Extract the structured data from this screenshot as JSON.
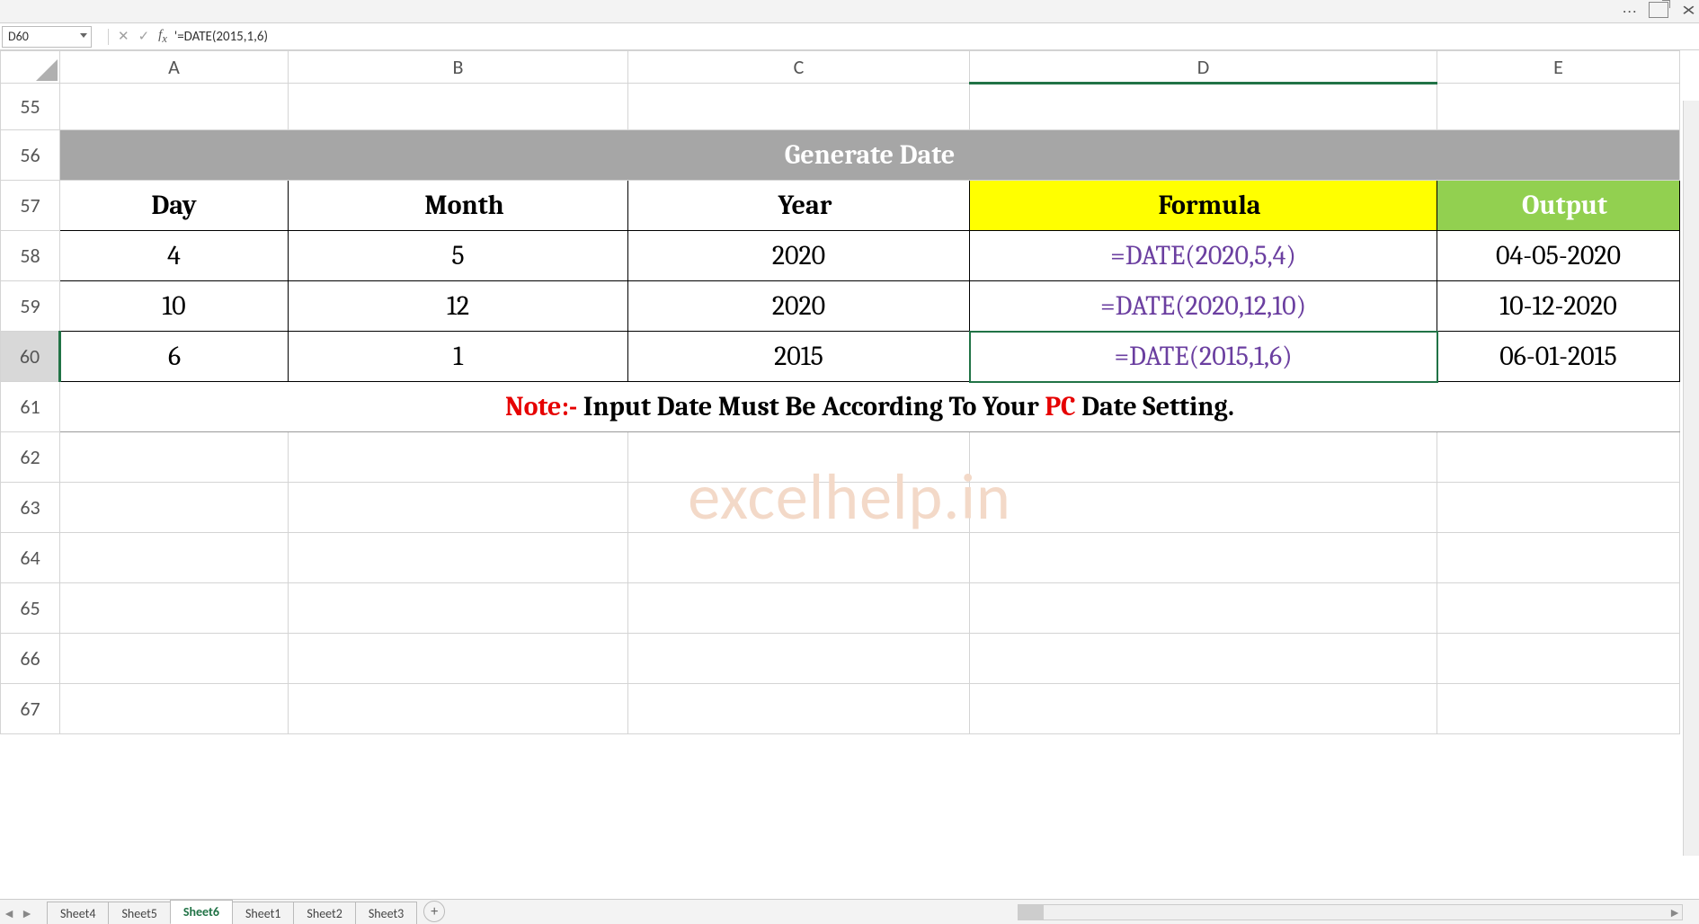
{
  "titlebar": {
    "dots": "···"
  },
  "namebox": {
    "cellref": "D60"
  },
  "formulabar": {
    "content": "'=DATE(2015,1,6)"
  },
  "columns": [
    "A",
    "B",
    "C",
    "D",
    "E"
  ],
  "rownums": [
    "55",
    "56",
    "57",
    "58",
    "59",
    "60",
    "61",
    "62",
    "63",
    "64",
    "65",
    "66",
    "67"
  ],
  "section_title": "Generate Date",
  "headers": {
    "day": "Day",
    "month": "Month",
    "year": "Year",
    "formula": "Formula",
    "output": "Output"
  },
  "rows": [
    {
      "day": "4",
      "month": "5",
      "year": "2020",
      "formula": "=DATE(2020,5,4)",
      "output": "04-05-2020"
    },
    {
      "day": "10",
      "month": "12",
      "year": "2020",
      "formula": "=DATE(2020,12,10)",
      "output": "10-12-2020"
    },
    {
      "day": "6",
      "month": "1",
      "year": "2015",
      "formula": "=DATE(2015,1,6)",
      "output": "06-01-2015"
    }
  ],
  "note": {
    "prefix": "Note:- ",
    "mid1": "Input Date Must Be According To Your ",
    "pc": "PC",
    "mid2": " Date Setting."
  },
  "watermark": "excelhelp.in",
  "sheets": [
    "Sheet4",
    "Sheet5",
    "Sheet6",
    "Sheet1",
    "Sheet2",
    "Sheet3"
  ],
  "active_sheet": "Sheet6"
}
